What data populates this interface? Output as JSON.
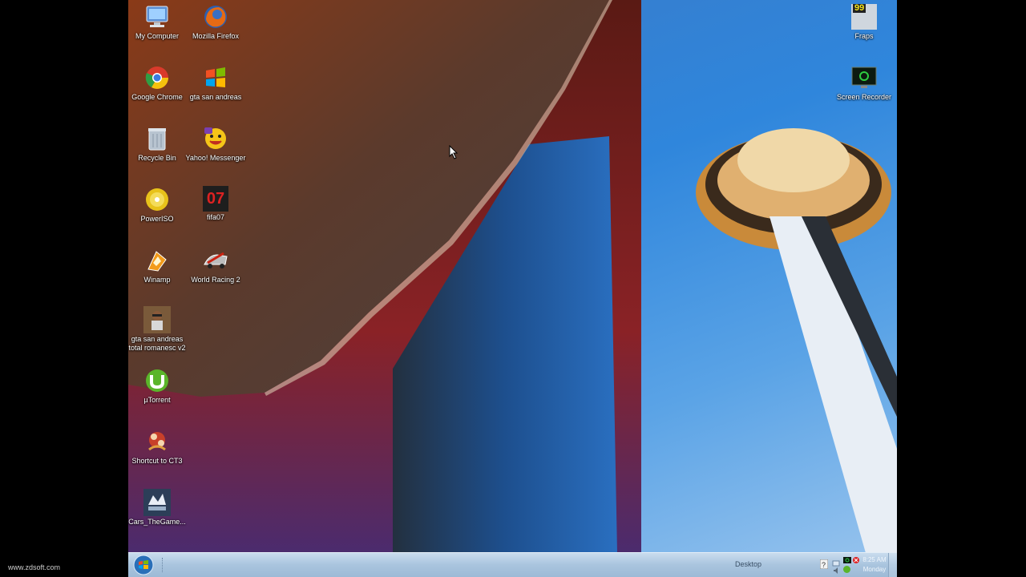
{
  "desktop": {
    "icons": [
      {
        "label": "My Computer",
        "icon": "computer-icon"
      },
      {
        "label": "Mozilla Firefox",
        "icon": "firefox-icon"
      },
      {
        "label": "Google Chrome",
        "icon": "chrome-icon"
      },
      {
        "label": "gta san andreas",
        "icon": "windows-flag-icon"
      },
      {
        "label": "Recycle Bin",
        "icon": "recycle-bin-icon"
      },
      {
        "label": "Yahoo! Messenger",
        "icon": "yahoo-messenger-icon"
      },
      {
        "label": "PowerISO",
        "icon": "poweriso-disc-icon"
      },
      {
        "label": "fifa07",
        "icon": "fifa07-icon"
      },
      {
        "label": "Winamp",
        "icon": "winamp-icon"
      },
      {
        "label": "World Racing 2",
        "icon": "world-racing-icon"
      },
      {
        "label": "gta san andreas total romanesc v2",
        "icon": "gta-character-icon"
      },
      {
        "label": "µTorrent",
        "icon": "utorrent-icon"
      },
      {
        "label": "Shortcut to CT3",
        "icon": "ct3-icon"
      },
      {
        "label": "Cars_TheGame...",
        "icon": "cars-game-icon"
      },
      {
        "label": "Fraps",
        "icon": "fraps-icon"
      },
      {
        "label": "Screen Recorder",
        "icon": "screen-recorder-icon"
      }
    ]
  },
  "fraps_counter": "99",
  "fifa_text": "07",
  "taskbar": {
    "desktop_label": "Desktop",
    "clock_time": "8:25 AM",
    "clock_day": "Monday"
  },
  "watermark": "www.zdsoft.com",
  "colors": {
    "sky": "#2f86dc",
    "taskbar": "#a9c4de"
  }
}
